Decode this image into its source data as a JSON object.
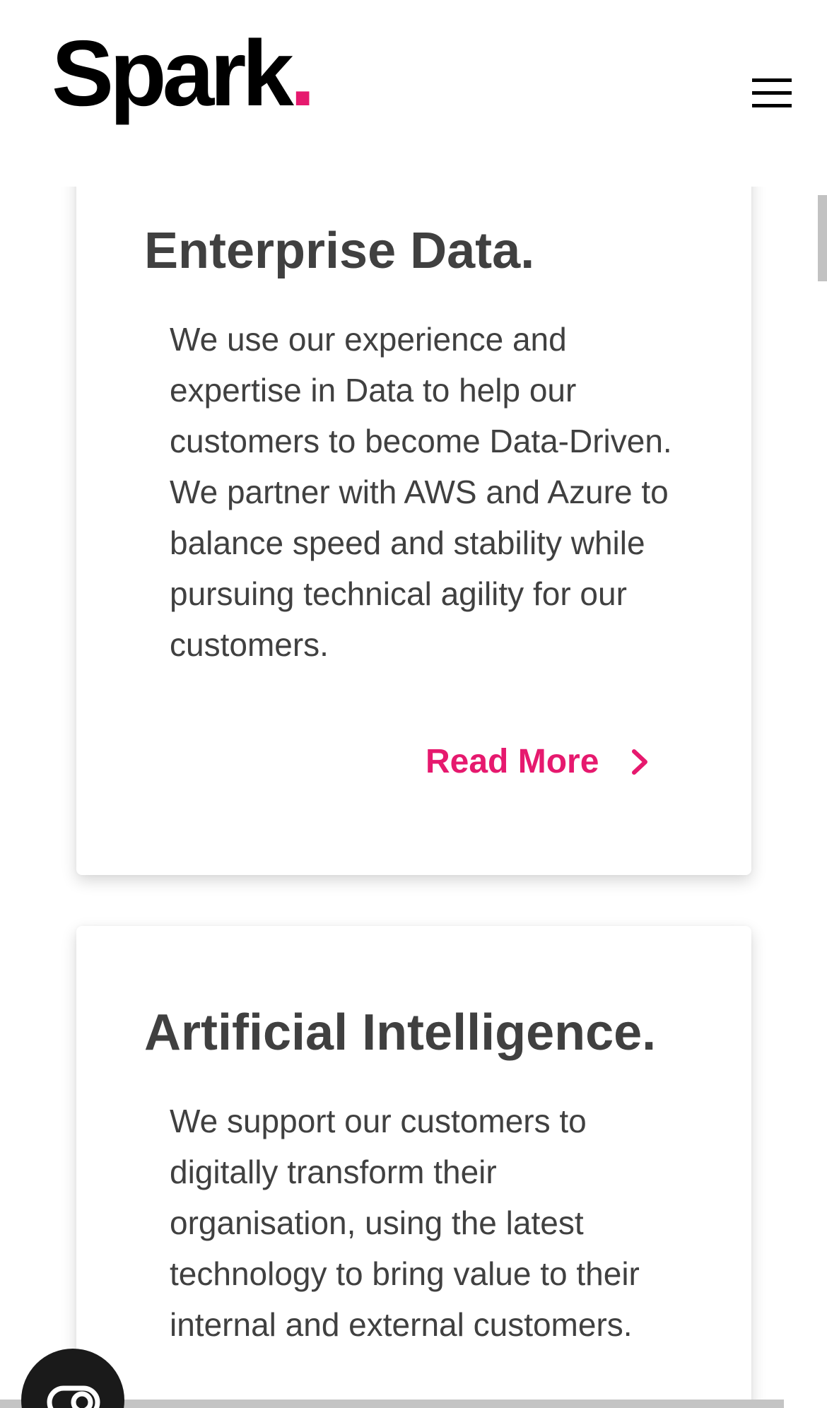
{
  "header": {
    "logo_text": "Spark",
    "logo_dot": ".",
    "menu_icon": "hamburger-menu-icon"
  },
  "cards": [
    {
      "title": "Enterprise Data.",
      "body": "We use our experience and expertise in Data to help our customers to become Data-Driven. We partner with AWS and Azure to balance speed and stability while pursuing technical agility for our customers.",
      "link_label": "Read More",
      "link_icon": "chevron-right-icon"
    },
    {
      "title": "Artificial Intelligence.",
      "body": "We support our customers to digitally transform their organisation, using the latest technology to bring value to their internal and external customers."
    }
  ],
  "chat_widget": {
    "icon": "chat-icon"
  },
  "colors": {
    "accent": "#e6196e",
    "text": "#404040",
    "logo": "#000000",
    "fab": "#1a1a1a"
  }
}
